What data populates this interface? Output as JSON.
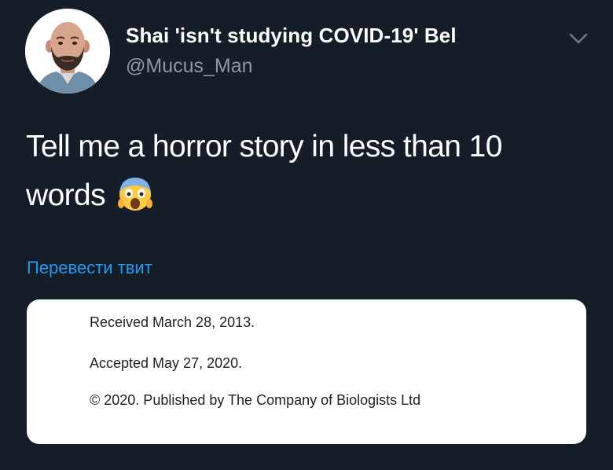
{
  "author": {
    "display_name": "Shai 'isn't studying COVID-19' Bel",
    "handle": "@Mucus_Man"
  },
  "menu": {
    "icon": "chevron-down-icon"
  },
  "tweet": {
    "text": "Tell me a horror story in less than 10 words",
    "emoji": "face-screaming-in-fear",
    "translate_label": "Перевести твит"
  },
  "attached_image": {
    "lines": [
      "Received March 28, 2013.",
      "Accepted May 27, 2020.",
      "© 2020. Published by The Company of Biologists Ltd"
    ]
  },
  "colors": {
    "background": "#151d29",
    "text": "#ffffff",
    "secondary_text": "#8b98a5",
    "link": "#1d9bf0"
  }
}
